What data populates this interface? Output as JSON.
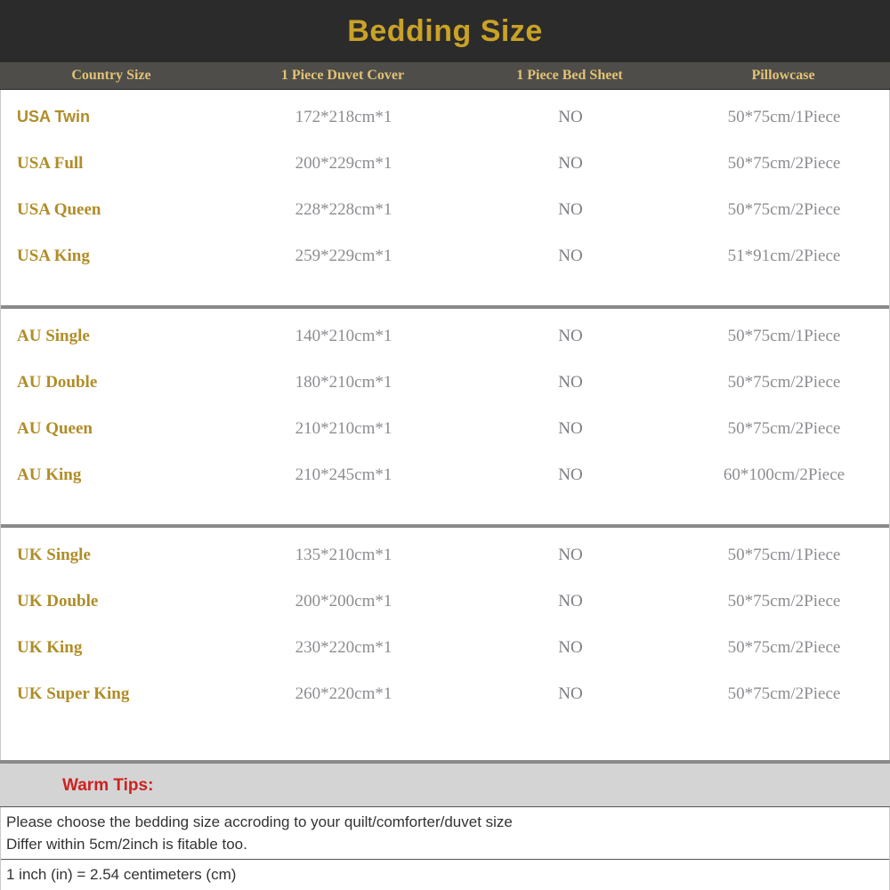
{
  "title": "Bedding Size",
  "columns": [
    "Country Size",
    "1 Piece Duvet Cover",
    "1 Piece Bed Sheet",
    "Pillowcase"
  ],
  "sections": [
    {
      "name": "USA",
      "rows": [
        {
          "country": "USA Twin",
          "duvet": "172*218cm*1",
          "sheet": "NO",
          "pillowcase": "50*75cm/1Piece"
        },
        {
          "country": "USA Full",
          "duvet": "200*229cm*1",
          "sheet": "NO",
          "pillowcase": "50*75cm/2Piece"
        },
        {
          "country": "USA Queen",
          "duvet": "228*228cm*1",
          "sheet": "NO",
          "pillowcase": "50*75cm/2Piece"
        },
        {
          "country": "USA King",
          "duvet": "259*229cm*1",
          "sheet": "NO",
          "pillowcase": "51*91cm/2Piece"
        }
      ]
    },
    {
      "name": "AU",
      "rows": [
        {
          "country": "AU Single",
          "duvet": "140*210cm*1",
          "sheet": "NO",
          "pillowcase": "50*75cm/1Piece"
        },
        {
          "country": "AU Double",
          "duvet": "180*210cm*1",
          "sheet": "NO",
          "pillowcase": "50*75cm/2Piece"
        },
        {
          "country": "AU Queen",
          "duvet": "210*210cm*1",
          "sheet": "NO",
          "pillowcase": "50*75cm/2Piece"
        },
        {
          "country": "AU King",
          "duvet": "210*245cm*1",
          "sheet": "NO",
          "pillowcase": "60*100cm/2Piece"
        }
      ]
    },
    {
      "name": "UK",
      "rows": [
        {
          "country": "UK Single",
          "duvet": "135*210cm*1",
          "sheet": "NO",
          "pillowcase": "50*75cm/1Piece"
        },
        {
          "country": "UK Double",
          "duvet": "200*200cm*1",
          "sheet": "NO",
          "pillowcase": "50*75cm/2Piece"
        },
        {
          "country": "UK King",
          "duvet": "230*220cm*1",
          "sheet": "NO",
          "pillowcase": "50*75cm/2Piece"
        },
        {
          "country": "UK Super King",
          "duvet": "260*220cm*1",
          "sheet": "NO",
          "pillowcase": "50*75cm/2Piece"
        }
      ]
    }
  ],
  "tips": {
    "heading": "Warm Tips:",
    "line1": "Please choose the bedding size accroding to your quilt/comforter/duvet size",
    "line2": "Differ within 5cm/2inch is fitable too.",
    "line3": "1 inch (in) = 2.54 centimeters (cm)"
  },
  "colors": {
    "title_bg": "#2b2b2b",
    "title_text": "#c9a227",
    "header_bg": "#4e4d49",
    "header_text": "#e2c275",
    "country_text": "#b08d28",
    "value_text": "#8d8d92",
    "tips_bg": "#d4d4d4",
    "tips_text": "#cc2222",
    "divider": "#8a8a8a"
  }
}
